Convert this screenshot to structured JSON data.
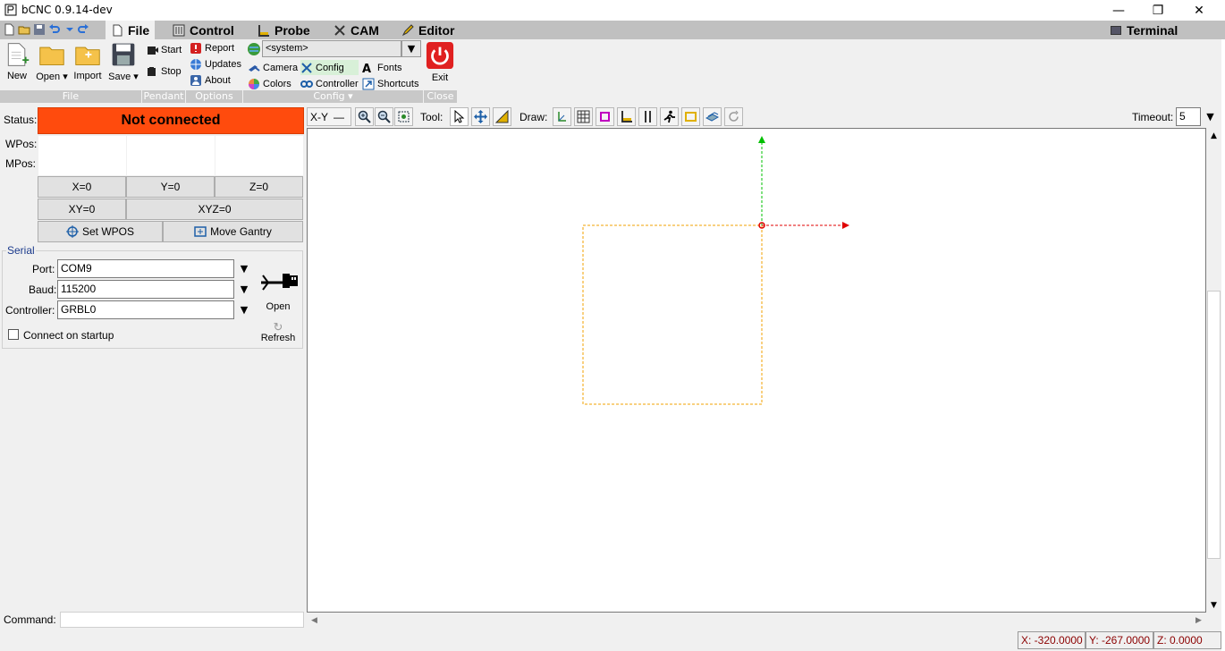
{
  "window": {
    "title": "bCNC 0.9.14-dev",
    "minimize": "—",
    "maximize": "❐",
    "close": "✕"
  },
  "tabs": [
    {
      "label": "File",
      "active": true
    },
    {
      "label": "Control"
    },
    {
      "label": "Probe"
    },
    {
      "label": "CAM"
    },
    {
      "label": "Editor"
    }
  ],
  "terminal_tab": "Terminal",
  "ribbon": {
    "file": {
      "new": "New",
      "open": "Open",
      "import": "Import",
      "save": "Save",
      "group": "File"
    },
    "pendant": {
      "start": "Start",
      "stop": "Stop",
      "group": "Pendant"
    },
    "options": {
      "report": "Report",
      "updates": "Updates",
      "about": "About",
      "group": "Options"
    },
    "config": {
      "language": "<system>",
      "camera": "Camera",
      "config": "Config",
      "fonts": "Fonts",
      "colors": "Colors",
      "controller": "Controller",
      "shortcuts": "Shortcuts",
      "group": "Config"
    },
    "close": {
      "exit": "Exit",
      "group": "Close"
    }
  },
  "status": {
    "label": "Status:",
    "value": "Not connected"
  },
  "position": {
    "wpos_label": "WPos:",
    "mpos_label": "MPos:"
  },
  "zero_buttons": {
    "x": "X=0",
    "y": "Y=0",
    "z": "Z=0",
    "xy": "XY=0",
    "xyz": "XYZ=0",
    "set_wpos": "Set WPOS",
    "move_gantry": "Move Gantry"
  },
  "serial": {
    "legend": "Serial",
    "port_label": "Port:",
    "port_value": "COM9",
    "baud_label": "Baud:",
    "baud_value": "115200",
    "controller_label": "Controller:",
    "controller_value": "GRBL0",
    "open": "Open",
    "refresh": "Refresh",
    "connect_on_startup": "Connect on startup",
    "connect_checked": false
  },
  "canvas_toolbar": {
    "view": "X-Y",
    "tool_label": "Tool:",
    "draw_label": "Draw:",
    "timeout_label": "Timeout:",
    "timeout_value": "5"
  },
  "command": {
    "label": "Command:"
  },
  "coords": {
    "x": "X: -320.0000",
    "y": "Y: -267.0000",
    "z": "Z: 0.0000"
  },
  "colors": {
    "status_bg": "#ff4b0d",
    "axis_x": "#e00000",
    "axis_y": "#00c000",
    "margin": "#f0a000"
  }
}
